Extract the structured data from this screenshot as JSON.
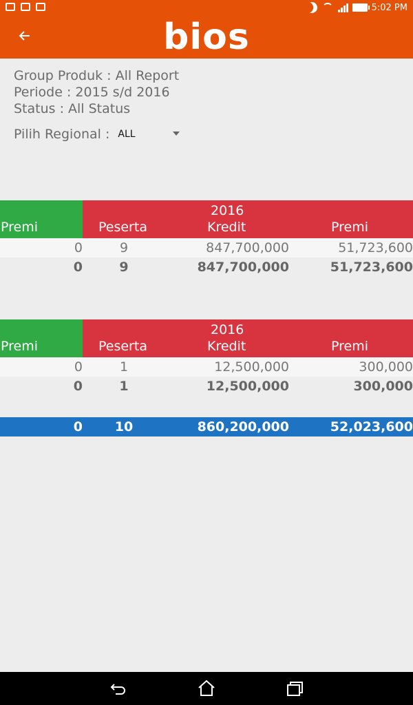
{
  "statusbar": {
    "time": "5:02 PM"
  },
  "appbar": {
    "logo": "bios",
    "back_icon": "arrow-left-icon"
  },
  "info": {
    "group_produk": "Group Produk : All Report",
    "periode": "Periode : 2015 s/d 2016",
    "status": "Status : All Status"
  },
  "regional": {
    "label": "Pilih Regional :",
    "value": "ALL"
  },
  "table1": {
    "year": "2016",
    "headers": {
      "premi_left": "Premi",
      "peserta": "Peserta",
      "kredit": "Kredit",
      "premi": "Premi"
    },
    "rows": [
      {
        "premi_left": "0",
        "peserta": "9",
        "kredit": "847,700,000",
        "premi": "51,723,600"
      }
    ],
    "subtotal": {
      "premi_left": "0",
      "peserta": "9",
      "kredit": "847,700,000",
      "premi": "51,723,600"
    }
  },
  "table2": {
    "year": "2016",
    "headers": {
      "premi_left": "Premi",
      "peserta": "Peserta",
      "kredit": "Kredit",
      "premi": "Premi"
    },
    "rows": [
      {
        "premi_left": "0",
        "peserta": "1",
        "kredit": "12,500,000",
        "premi": "300,000"
      }
    ],
    "subtotal": {
      "premi_left": "0",
      "peserta": "1",
      "kredit": "12,500,000",
      "premi": "300,000"
    }
  },
  "total": {
    "premi_left": "0",
    "peserta": "10",
    "kredit": "860,200,000",
    "premi": "52,023,600"
  },
  "colors": {
    "appbar": "#e65108",
    "green": "#2faa44",
    "red": "#d83440",
    "total": "#1e73c3"
  }
}
